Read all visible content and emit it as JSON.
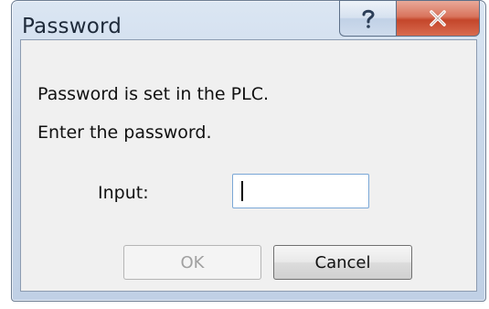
{
  "window": {
    "title": "Password"
  },
  "caption_buttons": {
    "help_icon": "question-mark-icon",
    "close_icon": "close-x-icon"
  },
  "message": {
    "line1": "Password is set in the PLC.",
    "line2": "Enter the password."
  },
  "form": {
    "input_label": "Input:",
    "input_value": ""
  },
  "buttons": {
    "ok_label": "OK",
    "ok_enabled": false,
    "cancel_label": "Cancel"
  },
  "colors": {
    "close_button": "#c4462b",
    "disabled_text": "#a0a0a0",
    "input_border": "#7aa7d6"
  }
}
